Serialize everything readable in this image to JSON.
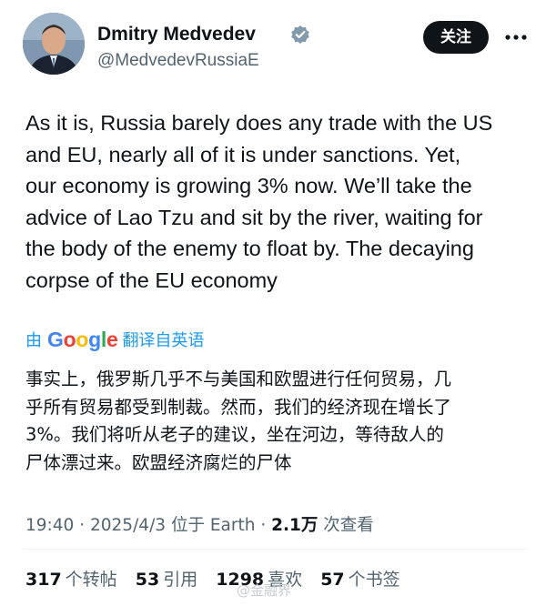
{
  "author": {
    "name": "Dmitry Medvedev",
    "handle": "@MedvedevRussiaE",
    "verified_icon": "verified-badge-icon"
  },
  "actions": {
    "follow_label": "关注",
    "more_icon": "more-dots-icon"
  },
  "tweet": {
    "text": "As it is, Russia barely does any trade with the US\nand EU, nearly all of it is under sanctions. Yet,\nour economy is growing 3% now. We’ll take the\nadvice of Lao Tzu and sit by the river, waiting for\nthe body of the enemy to float by. The decaying\ncorpse of the EU economy"
  },
  "translation": {
    "by": "由",
    "provider": "Google",
    "from_language": "翻译自英语",
    "text": "事实上，俄罗斯几乎不与美国和欧盟进行任何贸易，几\n乎所有贸易都受到制裁。然而，我们的经济现在增长了\n3%。我们将听从老子的建议，坐在河边，等待敌人的\n尸体漂过来。欧盟经济腐烂的尸体"
  },
  "meta": {
    "time": "19:40",
    "date": "2025/4/3",
    "location": "位于 Earth",
    "views_count": "2.1万",
    "views_label": "次查看"
  },
  "stats": {
    "reposts_count": "317",
    "reposts_label": "个转帖",
    "quotes_count": "53",
    "quotes_label": "引用",
    "likes_count": "1298",
    "likes_label": "喜欢",
    "bookmarks_count": "57",
    "bookmarks_label": "个书签"
  },
  "watermark": {
    "text": "@金融界"
  },
  "colors": {
    "link_blue": "#1d9bf0",
    "text": "#0f1419",
    "secondary": "#536471",
    "button_bg": "#0f1419"
  }
}
